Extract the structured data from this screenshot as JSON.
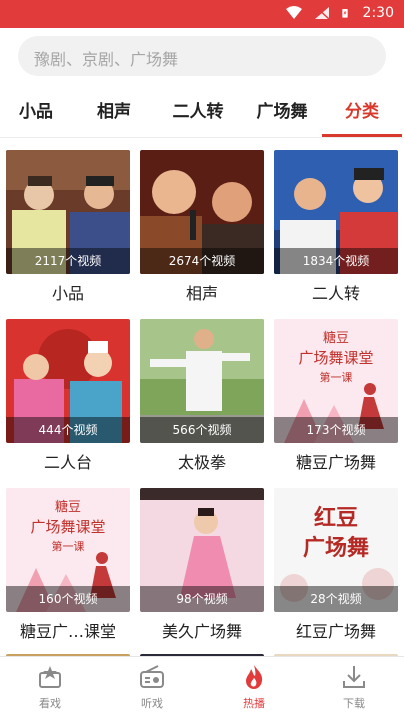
{
  "status": {
    "time": "2:30"
  },
  "search": {
    "placeholder": "豫剧、京剧、广场舞"
  },
  "tabs": [
    {
      "label": "小品"
    },
    {
      "label": "相声"
    },
    {
      "label": "二人转"
    },
    {
      "label": "广场舞"
    },
    {
      "label": "分类",
      "active": true
    }
  ],
  "cards": [
    {
      "title": "小品",
      "count": "2117个视频"
    },
    {
      "title": "相声",
      "count": "2674个视频"
    },
    {
      "title": "二人转",
      "count": "1834个视频"
    },
    {
      "title": "二人台",
      "count": "444个视频"
    },
    {
      "title": "太极拳",
      "count": "566个视频"
    },
    {
      "title": "糖豆广场舞",
      "count": "173个视频"
    },
    {
      "title": "糖豆广…课堂",
      "count": "160个视频"
    },
    {
      "title": "美久广场舞",
      "count": "98个视频"
    },
    {
      "title": "红豆广场舞",
      "count": "28个视频"
    }
  ],
  "thumb_text": {
    "tangdou_top": "糖豆",
    "tangdou_mid": "广场舞课堂",
    "tangdou_sub": "第一课",
    "hongdou_1": "红豆",
    "hongdou_2": "广场舞"
  },
  "bottom_nav": [
    {
      "label": "看戏",
      "icon": "star-video-icon"
    },
    {
      "label": "听戏",
      "icon": "radio-icon"
    },
    {
      "label": "热播",
      "icon": "flame-icon",
      "active": true
    },
    {
      "label": "下载",
      "icon": "download-icon"
    }
  ],
  "colors": {
    "accent": "#d8392c",
    "statusbar": "#e23b3b"
  }
}
